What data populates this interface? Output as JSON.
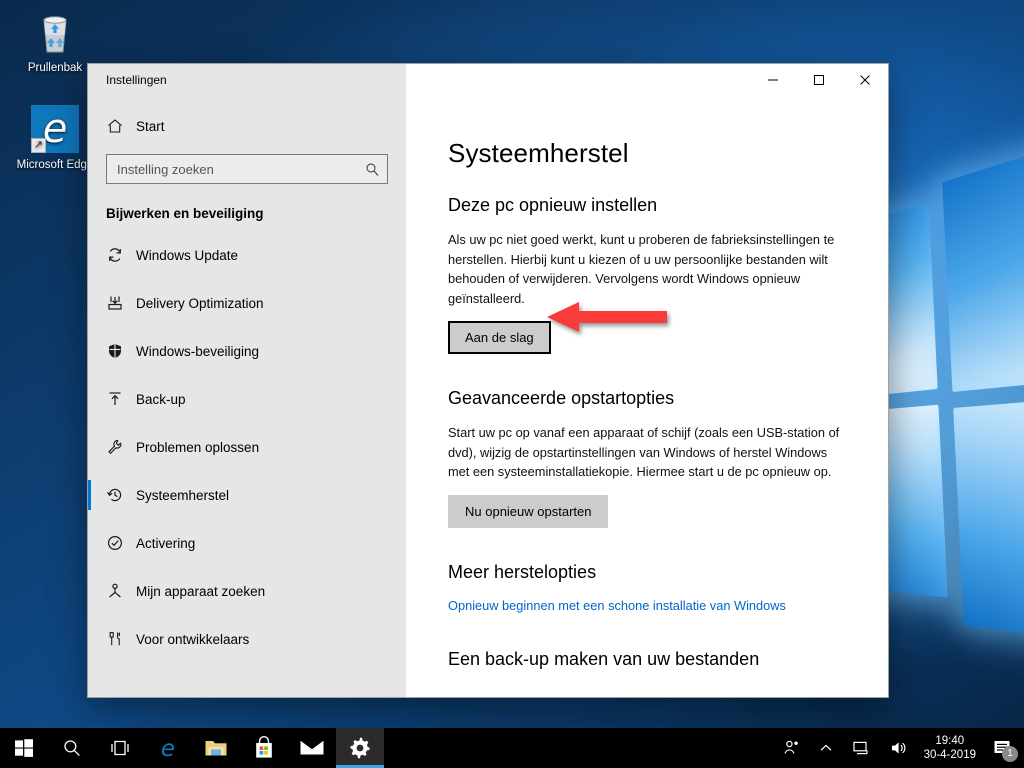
{
  "desktop": {
    "icons": [
      {
        "name": "recycle-bin",
        "label": "Prullenbak"
      },
      {
        "name": "microsoft-edge",
        "label": "Microsoft Edge"
      }
    ]
  },
  "window": {
    "title": "Instellingen",
    "controls": {
      "minimize": "—",
      "maximize": "☐",
      "close": "✕"
    }
  },
  "sidebar": {
    "home": {
      "label": "Start",
      "icon": "home-icon"
    },
    "search": {
      "placeholder": "Instelling zoeken",
      "value": "",
      "icon": "search-icon"
    },
    "category": "Bijwerken en beveiliging",
    "items": [
      {
        "label": "Windows Update",
        "icon": "refresh-icon",
        "selected": false
      },
      {
        "label": "Delivery Optimization",
        "icon": "download-box-icon",
        "selected": false
      },
      {
        "label": "Windows-beveiliging",
        "icon": "shield-icon",
        "selected": false
      },
      {
        "label": "Back-up",
        "icon": "upload-arrow-icon",
        "selected": false
      },
      {
        "label": "Problemen oplossen",
        "icon": "wrench-icon",
        "selected": false
      },
      {
        "label": "Systeemherstel",
        "icon": "history-icon",
        "selected": true
      },
      {
        "label": "Activering",
        "icon": "check-circle-icon",
        "selected": false
      },
      {
        "label": "Mijn apparaat zoeken",
        "icon": "locate-icon",
        "selected": false
      },
      {
        "label": "Voor ontwikkelaars",
        "icon": "tools-icon",
        "selected": false
      }
    ],
    "accent_color": "#0078d7"
  },
  "main": {
    "page_title": "Systeemherstel",
    "sections": [
      {
        "heading": "Deze pc opnieuw instellen",
        "body": "Als uw pc niet goed werkt, kunt u proberen de fabrieksinstellingen te herstellen. Hierbij kunt u kiezen of u uw persoonlijke bestanden wilt behouden of verwijderen. Vervolgens wordt Windows opnieuw geïnstalleerd.",
        "button": "Aan de slag"
      },
      {
        "heading": "Geavanceerde opstartopties",
        "body": "Start uw pc op vanaf een apparaat of schijf (zoals een USB-station of dvd), wijzig de opstartinstellingen van Windows of herstel Windows met een systeeminstallatiekopie. Hiermee start u de pc opnieuw op.",
        "button": "Nu opnieuw opstarten"
      },
      {
        "heading": "Meer herstelopties",
        "link": "Opnieuw beginnen met een schone installatie van Windows"
      },
      {
        "heading": "Een back-up maken van uw bestanden"
      }
    ],
    "annotation": {
      "type": "arrow",
      "direction": "left",
      "color": "#f93b3b",
      "points_to": "Aan de slag"
    }
  },
  "taskbar": {
    "items": [
      {
        "name": "start-button",
        "icon": "windows-logo-icon",
        "active": false
      },
      {
        "name": "search-button",
        "icon": "search-icon",
        "active": false
      },
      {
        "name": "task-view-button",
        "icon": "task-view-icon",
        "active": false
      },
      {
        "name": "edge-button",
        "icon": "edge-icon",
        "active": false
      },
      {
        "name": "file-explorer-button",
        "icon": "folder-icon",
        "active": false
      },
      {
        "name": "microsoft-store-button",
        "icon": "store-icon",
        "active": false
      },
      {
        "name": "mail-button",
        "icon": "mail-icon",
        "active": false
      },
      {
        "name": "settings-button",
        "icon": "gear-icon",
        "active": true
      }
    ],
    "tray": {
      "icons": [
        "people-icon",
        "chevron-up-icon",
        "network-icon",
        "volume-icon"
      ],
      "time": "19:40",
      "date": "30-4-2019",
      "notifications": "1"
    }
  }
}
